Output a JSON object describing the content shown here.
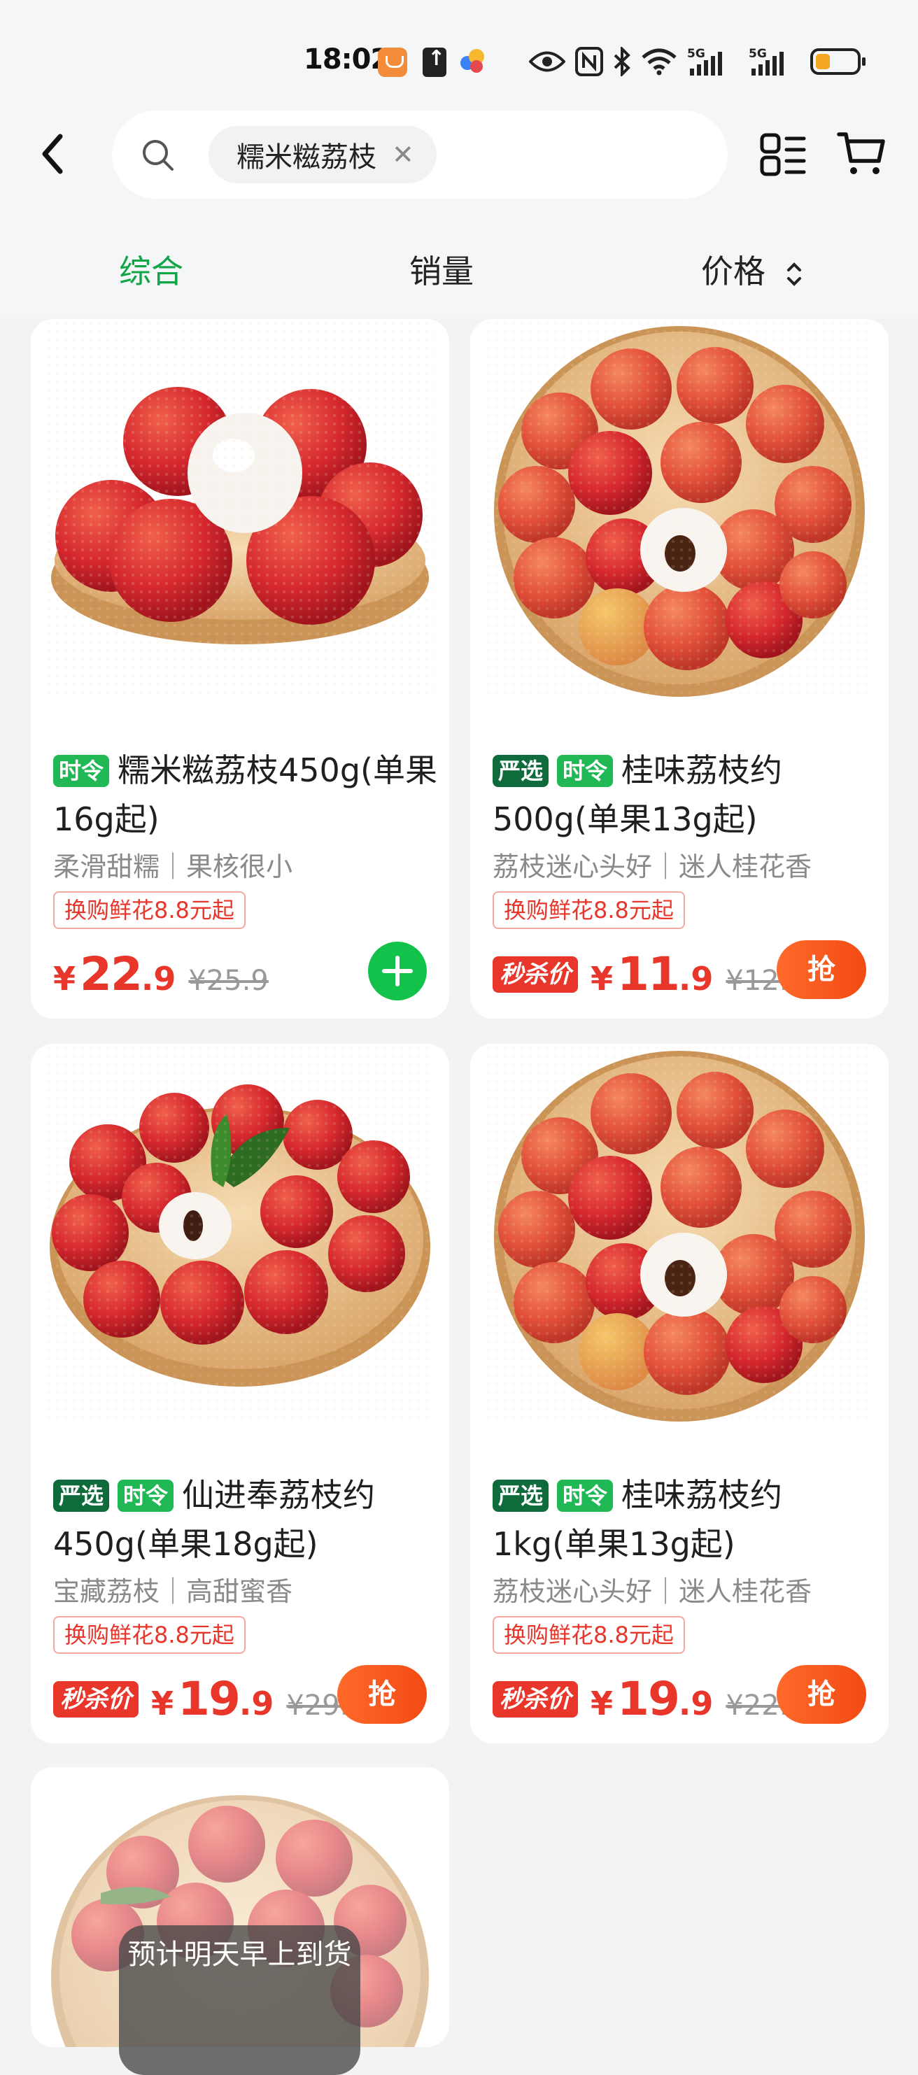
{
  "status_bar": {
    "time": "18:02",
    "icons": [
      "app-orange-icon",
      "upload-icon",
      "app-multicolor-icon",
      "eye-icon",
      "nfc-icon",
      "bluetooth-icon",
      "wifi-icon",
      "signal-5g-icon",
      "signal-5g-icon",
      "battery-low-icon"
    ],
    "signal_label_1": "5G",
    "signal_label_2": "5G",
    "battery_color": "#f5a623"
  },
  "header": {
    "search_query": "糯米糍荔枝",
    "icons": [
      "back-icon",
      "search-icon",
      "close-icon",
      "layout-toggle-icon",
      "cart-icon"
    ]
  },
  "sort_tabs": [
    {
      "label": "综合",
      "active": true
    },
    {
      "label": "销量",
      "active": false
    },
    {
      "label": "价格",
      "active": false
    }
  ],
  "colors": {
    "accent_green": "#12a547",
    "price_red": "#e8362b",
    "grab_orange": "#f24a14"
  },
  "products": [
    {
      "tags": [
        "时令"
      ],
      "title": "糯米糍荔枝450g(单果16g起)",
      "subtitle": "柔滑甜糯｜果核很小",
      "promo": "换购鲜花8.8元起",
      "flash_label": "",
      "price_currency": "¥",
      "price_int": "22",
      "price_dec": ".9",
      "original_price": "¥25.9",
      "action": "add"
    },
    {
      "tags": [
        "严选",
        "时令"
      ],
      "title": "桂味荔枝约500g(单果13g起)",
      "subtitle": "荔枝迷心头好｜迷人桂花香",
      "promo": "换购鲜花8.8元起",
      "flash_label": "秒杀价",
      "price_currency": "¥",
      "price_int": "11",
      "price_dec": ".9",
      "original_price": "¥12.9",
      "action_label": "抢"
    },
    {
      "tags": [
        "严选",
        "时令"
      ],
      "title": "仙进奉荔枝约450g(单果18g起)",
      "subtitle": "宝藏荔枝｜高甜蜜香",
      "promo": "换购鲜花8.8元起",
      "flash_label": "秒杀价",
      "price_currency": "¥",
      "price_int": "19",
      "price_dec": ".9",
      "original_price": "¥29.9",
      "action_label": "抢"
    },
    {
      "tags": [
        "严选",
        "时令"
      ],
      "title": "桂味荔枝约1kg(单果13g起)",
      "subtitle": "荔枝迷心头好｜迷人桂花香",
      "promo": "换购鲜花8.8元起",
      "flash_label": "秒杀价",
      "price_currency": "¥",
      "price_int": "19",
      "price_dec": ".9",
      "original_price": "¥22.9",
      "action_label": "抢"
    }
  ],
  "delivery_notice": "预计明天早上到货"
}
